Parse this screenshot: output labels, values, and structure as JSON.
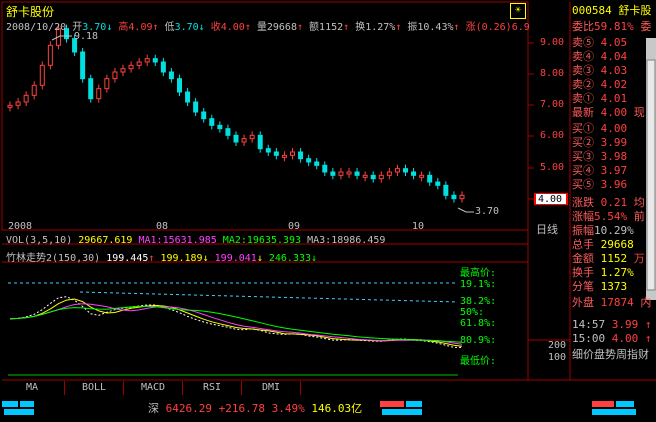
{
  "stock": {
    "name": "舒卡股份",
    "code": "000584",
    "short_name": "舒卡股"
  },
  "quote_bar": {
    "date": "2008/10/20",
    "open_label": "开",
    "open": "3.70",
    "high_label": "高",
    "high": "4.09",
    "low_label": "低",
    "low": "3.70",
    "close_label": "收",
    "close": "4.00",
    "volume_label": "量",
    "volume": "29668",
    "amount_label": "额",
    "amount": "1152",
    "turnover_label": "换",
    "turnover": "1.27%",
    "amplitude_label": "振",
    "amplitude": "10.43%",
    "change_label": "涨",
    "change": "(0.26)",
    "change_cut": "6.9"
  },
  "price_axis": [
    "9.00",
    "8.00",
    "7.00",
    "6.00",
    "5.00",
    "4.00"
  ],
  "price_axis_current": "4.00",
  "high_mark": "9.18",
  "low_mark": "3.70",
  "date_axis": [
    "2008",
    "08",
    "09",
    "10"
  ],
  "period_label": "日线",
  "vol_line": {
    "title": "VOL(3,5,10)",
    "vol": "29667.619",
    "ma1": "MA1:15631.985",
    "ma2": "MA2:19635.393",
    "ma3": "MA3:18986.459"
  },
  "indicator": {
    "title": "竹林走势2(150,30)",
    "v1": "199.445",
    "v2": "199.189",
    "v3": "199.041",
    "v4": "246.333",
    "levels": [
      "最高价:",
      "19.1%:",
      "38.2%:",
      "50%:",
      "61.8%:",
      "80.9%:",
      "最低价:"
    ],
    "axis": [
      "200",
      "100"
    ]
  },
  "tabs": [
    "MA",
    "BOLL",
    "MACD",
    "RSI",
    "DMI"
  ],
  "order_book": {
    "wei_bi_label": "委比",
    "wei_bi": "59.81%",
    "wei_cha_label": "委",
    "sells": [
      {
        "label": "卖⑤",
        "price": "4.05"
      },
      {
        "label": "卖④",
        "price": "4.04"
      },
      {
        "label": "卖③",
        "price": "4.03"
      },
      {
        "label": "卖②",
        "price": "4.02"
      },
      {
        "label": "卖①",
        "price": "4.01"
      }
    ],
    "latest_label": "最新",
    "latest": "4.00",
    "latest_cut": "现",
    "buys": [
      {
        "label": "买①",
        "price": "4.00"
      },
      {
        "label": "买②",
        "price": "3.99"
      },
      {
        "label": "买③",
        "price": "3.98"
      },
      {
        "label": "买④",
        "price": "3.97"
      },
      {
        "label": "买⑤",
        "price": "3.96"
      }
    ]
  },
  "stats": [
    {
      "label": "涨跌",
      "value": "0.21",
      "cut": "均"
    },
    {
      "label": "涨幅",
      "value": "5.54%",
      "cut": "前"
    },
    {
      "label": "振幅",
      "value": "10.29%",
      "cut": ""
    },
    {
      "label": "总手",
      "value": "29668",
      "cut": ""
    },
    {
      "label": "金额",
      "value": "1152",
      "cut": ""
    },
    {
      "label": "换手",
      "value": "1.27%",
      "cut": ""
    },
    {
      "label": "分笔",
      "value": "1373",
      "cut": ""
    }
  ],
  "outer": {
    "label": "外盘",
    "value": "17874",
    "cut": "内"
  },
  "ticks": [
    {
      "time": "14:57",
      "price": "3.99",
      "color": "#ff5a5a"
    },
    {
      "time": "15:00",
      "price": "4.00",
      "color": "#ff5a5a"
    }
  ],
  "bottom_tabs": "细价盘势周指财",
  "index_bar": {
    "name": "深",
    "value": "6426.29",
    "change": "+216.78",
    "pct": "3.49%",
    "amount": "146.03亿"
  },
  "colors": {
    "up": "#ff4040",
    "down": "#00e0e0",
    "grid": "#a00000",
    "yellow": "#ffff00",
    "magenta": "#ff40ff",
    "green": "#00ff00"
  },
  "chart_data": {
    "type": "line",
    "series": [
      {
        "values": [
          6.7,
          6.8,
          7.0,
          7.3,
          7.9,
          8.5,
          9.0,
          8.7,
          8.3,
          7.5,
          6.9,
          7.2,
          7.5,
          7.7,
          7.8,
          7.9,
          8.0,
          8.1,
          8.0,
          7.7,
          7.5,
          7.1,
          6.8,
          6.5,
          6.3,
          6.1,
          6.0,
          5.8,
          5.6,
          5.7,
          5.8,
          5.4,
          5.3,
          5.2,
          5.2,
          5.3,
          5.1,
          5.0,
          4.9,
          4.7,
          4.6,
          4.7,
          4.7,
          4.6,
          4.6,
          4.5,
          4.6,
          4.7,
          4.8,
          4.7,
          4.6,
          4.6,
          4.4,
          4.3,
          4.0,
          3.9,
          4.0
        ]
      }
    ],
    "ylim": [
      3.5,
      9.5
    ]
  }
}
